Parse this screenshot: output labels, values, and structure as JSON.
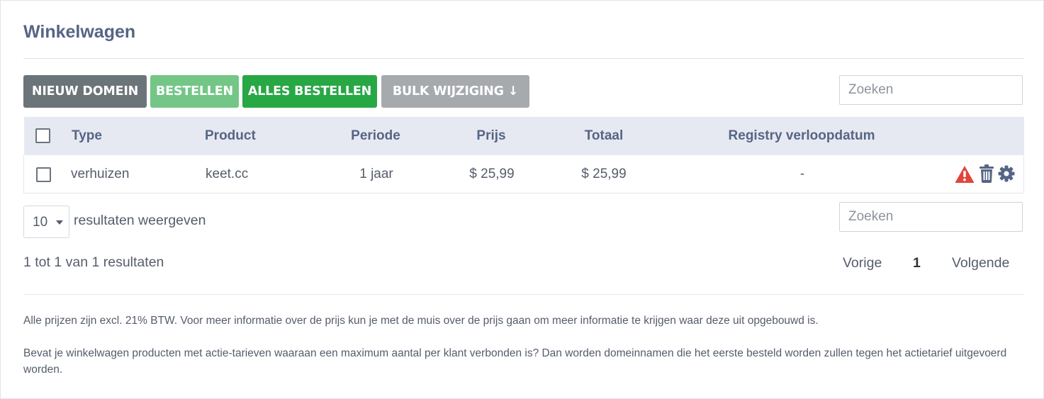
{
  "page": {
    "title": "Winkelwagen"
  },
  "toolbar": {
    "new_domain": "NIEUW DOMEIN",
    "order": "BESTELLEN",
    "order_all": "ALLES BESTELLEN",
    "bulk_edit": "BULK WIJZIGING ↓"
  },
  "search": {
    "placeholder": "Zoeken"
  },
  "table": {
    "headers": {
      "type": "Type",
      "product": "Product",
      "period": "Periode",
      "price": "Prijs",
      "total": "Totaal",
      "registry_expiry": "Registry verloopdatum"
    },
    "rows": [
      {
        "type": "verhuizen",
        "product": "keet.cc",
        "period": "1 jaar",
        "price": "$ 25,99",
        "total": "$ 25,99",
        "registry_expiry": "-",
        "actions": [
          "warning-icon",
          "trash-icon",
          "gear-icon"
        ]
      }
    ]
  },
  "length_menu": {
    "value": "10",
    "label": "resultaten weergeven"
  },
  "info": "1 tot 1 van 1 resultaten",
  "pagination": {
    "previous": "Vorige",
    "current": "1",
    "next": "Volgende"
  },
  "notes": [
    "Alle prijzen zijn excl. 21% BTW. Voor meer informatie over de prijs kun je met de muis over de prijs gaan om meer informatie te krijgen waar deze uit opgebouwd is.",
    "Bevat je winkelwagen producten met actie-tarieven waaraan een maximum aantal per klant verbonden is? Dan worden domeinnamen die het eerste besteld worden zullen tegen het actietarief uitgevoerd worden."
  ],
  "colors": {
    "title": "#566585",
    "btn_new": "#6b7479",
    "btn_order": "#74c687",
    "btn_order_all": "#28a745",
    "btn_bulk": "#a7aaad",
    "table_header_bg": "#e7e9f2",
    "warning": "#e0453a",
    "icon": "#566585"
  }
}
